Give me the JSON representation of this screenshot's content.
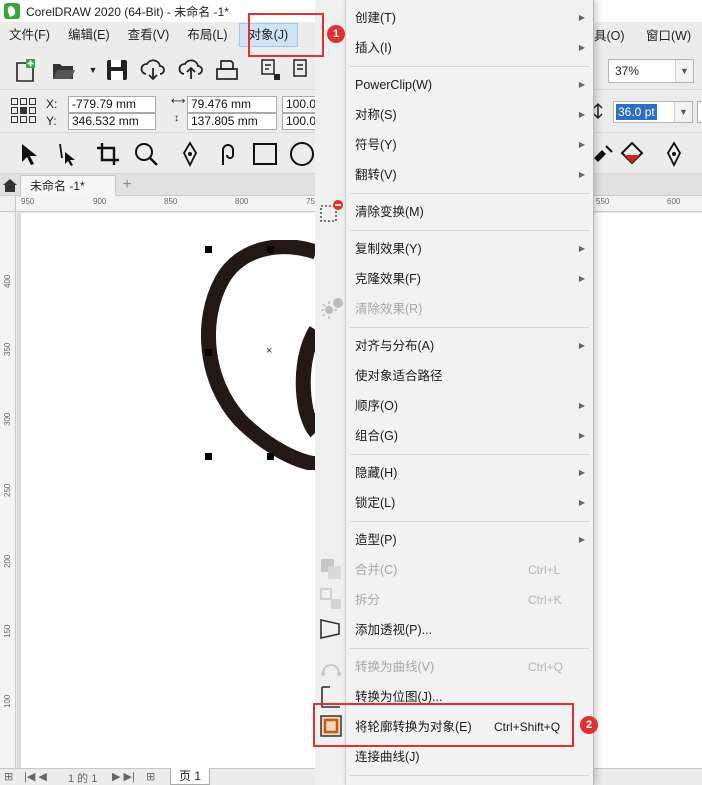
{
  "window": {
    "title": "CorelDRAW 2020 (64-Bit) - 未命名 -1*"
  },
  "menubar": {
    "items": [
      {
        "label": "文件(F)"
      },
      {
        "label": "编辑(E)"
      },
      {
        "label": "查看(V)"
      },
      {
        "label": "布局(L)"
      },
      {
        "label": "对象(J)"
      }
    ],
    "right_items": [
      {
        "label": "具(O)"
      },
      {
        "label": "窗口(W)"
      }
    ]
  },
  "zoom": {
    "value": "37%"
  },
  "font_size": {
    "value": "36.0 pt"
  },
  "properties": {
    "x_label": "X:",
    "x_value": "-779.79 mm",
    "y_label": "Y:",
    "y_value": "346.532 mm",
    "w_value": "79.476 mm",
    "h_value": "137.805 mm",
    "scale_x": "100.0",
    "scale_y": "100.0"
  },
  "document": {
    "tab_label": "未命名 -1*",
    "page_label": "页 1",
    "page_counter": "1 的 1"
  },
  "ruler": {
    "h_ticks": [
      "950",
      "900",
      "850",
      "800",
      "75",
      "550",
      "600",
      "650"
    ],
    "v_ticks": [
      "400",
      "350",
      "300",
      "250",
      "200",
      "150",
      "100"
    ]
  },
  "context_menu": {
    "items": [
      {
        "label": "创建(T)",
        "submenu": true
      },
      {
        "label": "插入(I)",
        "submenu": true
      },
      {
        "label": "PowerClip(W)",
        "submenu": true
      },
      {
        "label": "对称(S)",
        "submenu": true
      },
      {
        "label": "符号(Y)",
        "submenu": true
      },
      {
        "label": "翻转(V)",
        "submenu": true
      },
      {
        "label": "清除变换(M)"
      },
      {
        "label": "复制效果(Y)",
        "submenu": true
      },
      {
        "label": "克隆效果(F)",
        "submenu": true
      },
      {
        "label": "清除效果(R)",
        "disabled": true
      },
      {
        "label": "对齐与分布(A)",
        "submenu": true
      },
      {
        "label": "使对象适合路径"
      },
      {
        "label": "顺序(O)",
        "submenu": true
      },
      {
        "label": "组合(G)",
        "submenu": true
      },
      {
        "label": "隐藏(H)",
        "submenu": true
      },
      {
        "label": "锁定(L)",
        "submenu": true
      },
      {
        "label": "造型(P)",
        "submenu": true
      },
      {
        "label": "合并(C)",
        "shortcut": "Ctrl+L",
        "disabled": true
      },
      {
        "label": "拆分",
        "shortcut": "Ctrl+K",
        "disabled": true
      },
      {
        "label": "添加透视(P)..."
      },
      {
        "label": "转换为曲线(V)",
        "shortcut": "Ctrl+Q",
        "disabled": true
      },
      {
        "label": "转换为位图(J)..."
      },
      {
        "label": "将轮廓转换为对象(E)",
        "shortcut": "Ctrl+Shift+Q"
      },
      {
        "label": "连接曲线(J)"
      }
    ]
  },
  "annotations": {
    "step1": "1",
    "step2": "2",
    "color": "#e0302f"
  }
}
